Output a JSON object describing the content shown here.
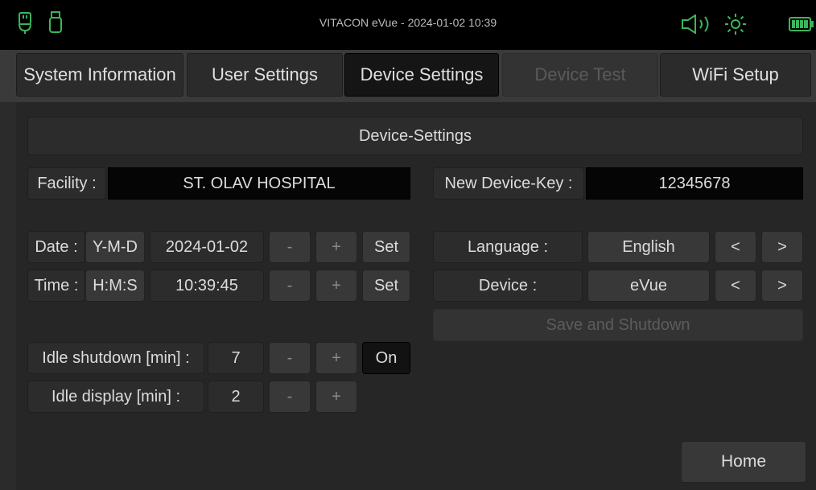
{
  "title": "VITACON eVue - 2024-01-02 10:39",
  "icons": {
    "usb": "usb-plug-icon",
    "usb2": "usb-drive-icon",
    "sound": "speaker-icon",
    "brightness": "sun-icon",
    "battery": "battery-icon"
  },
  "colors": {
    "status_green": "#2fa84f",
    "active_tab": "#151515"
  },
  "tabs": [
    {
      "label": "System Information"
    },
    {
      "label": "User Settings"
    },
    {
      "label": "Device Settings"
    },
    {
      "label": "Device Test"
    },
    {
      "label": "WiFi Setup"
    }
  ],
  "section_title": "Device-Settings",
  "facility": {
    "label": "Facility :",
    "value": "ST. OLAV HOSPITAL"
  },
  "device_key": {
    "label": "New Device-Key :",
    "value": "12345678"
  },
  "date": {
    "label": "Date :",
    "format": "Y-M-D",
    "value": "2024-01-02",
    "minus": "-",
    "plus": "+",
    "set": "Set"
  },
  "time": {
    "label": "Time :",
    "format": "H:M:S",
    "value": "10:39:45",
    "minus": "-",
    "plus": "+",
    "set": "Set"
  },
  "language": {
    "label": "Language :",
    "value": "English",
    "prev": "<",
    "next": ">"
  },
  "device": {
    "label": "Device :",
    "value": "eVue",
    "prev": "<",
    "next": ">"
  },
  "save_shutdown": "Save and Shutdown",
  "idle_shutdown": {
    "label": "Idle shutdown [min] :",
    "value": "7",
    "minus": "-",
    "plus": "+",
    "toggle": "On"
  },
  "idle_display": {
    "label": "Idle display [min] :",
    "value": "2",
    "minus": "-",
    "plus": "+"
  },
  "home": "Home"
}
